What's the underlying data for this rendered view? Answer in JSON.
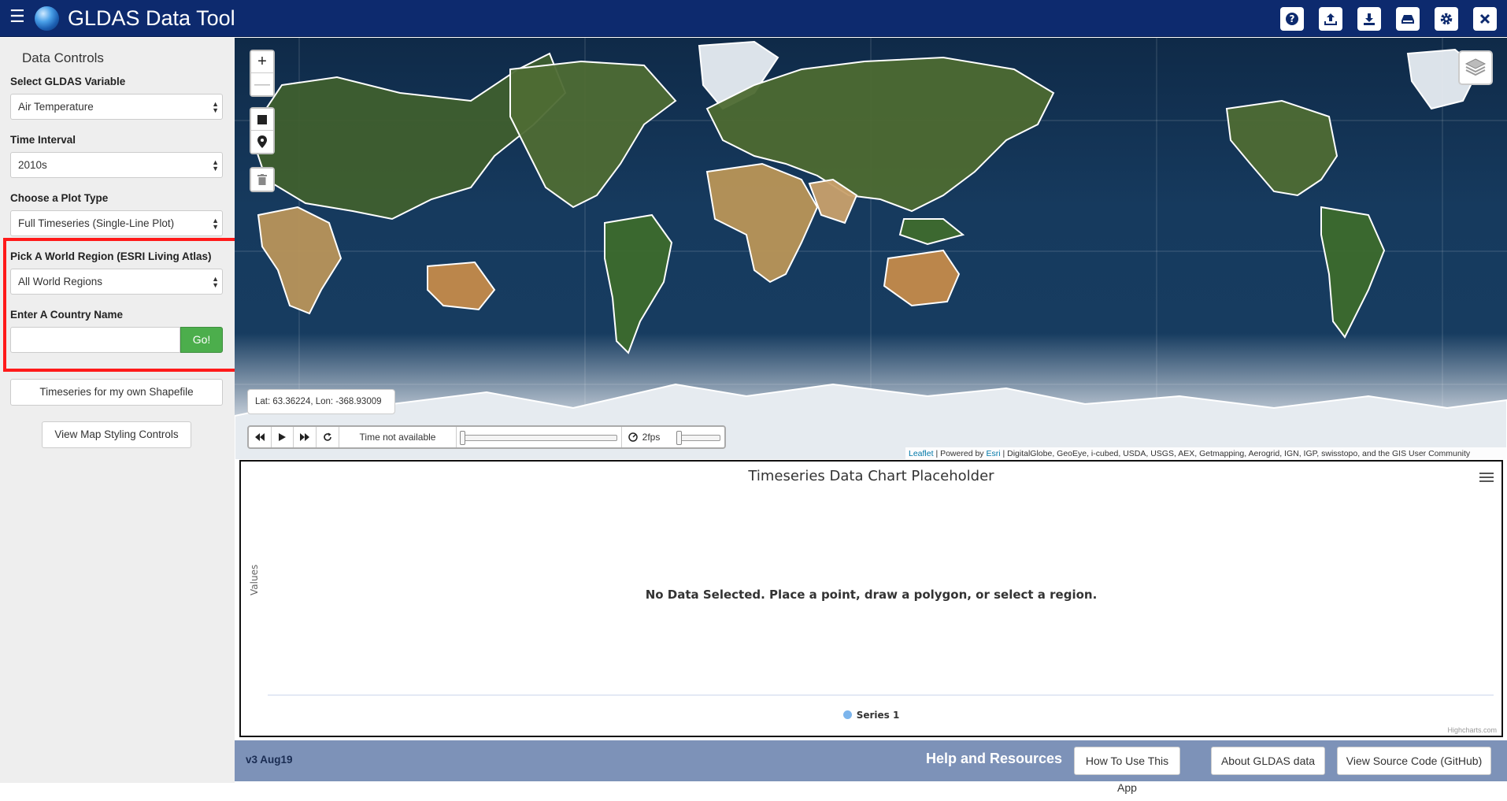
{
  "header": {
    "title": "GLDAS Data Tool",
    "icons": [
      "menu-icon",
      "globe-logo",
      "help-icon",
      "upload-icon",
      "download-icon",
      "hdd-icon",
      "settings-icon",
      "close-icon"
    ],
    "color": "#0d2a6e"
  },
  "sidebar": {
    "heading": "Data Controls",
    "variable": {
      "label": "Select GLDAS Variable",
      "value": "Air Temperature"
    },
    "time": {
      "label": "Time Interval",
      "value": "2010s"
    },
    "plot": {
      "label": "Choose a Plot Type",
      "value": "Full Timeseries (Single-Line Plot)"
    },
    "region": {
      "label": "Pick A World Region (ESRI Living Atlas)",
      "value": "All World Regions"
    },
    "country": {
      "label": "Enter A Country Name",
      "value": "",
      "go_label": "Go!"
    },
    "shapefile_button": "Timeseries for my own Shapefile",
    "styling_button": "View Map Styling Controls"
  },
  "map": {
    "zoom_in": "+",
    "zoom_out": "—",
    "coordinates": "Lat: 63.36224, Lon: -368.93009",
    "time_label": "Time not available",
    "fps_label": "2fps",
    "attribution": {
      "leaflet": "Leaflet",
      "powered": " | Powered by ",
      "esri": "Esri",
      "sources": " | DigitalGlobe, GeoEye, i-cubed, USDA, USGS, AEX, Getmapping, Aerogrid, IGN, IGP, swisstopo, and the GIS User Community"
    }
  },
  "chart_data": {
    "type": "line",
    "title": "Timeseries Data Chart Placeholder",
    "ylabel": "Values",
    "xlabel": "",
    "no_data_message": "No Data Selected. Place a point, draw a polygon, or select a region.",
    "series": [
      {
        "name": "Series 1",
        "values": [],
        "color": "#7cb5ec"
      }
    ],
    "credits": "Highcharts.com",
    "legend": "bottom-center"
  },
  "footer": {
    "version": "v3 Aug19",
    "help_heading": "Help and Resources",
    "buttons": [
      "How To Use This App",
      "About GLDAS data",
      "View Source Code (GitHub)"
    ],
    "color": "#7d92b8"
  },
  "annotation": {
    "box_color": "#ff1a1a",
    "arrow_color": "#ff1a1a"
  }
}
